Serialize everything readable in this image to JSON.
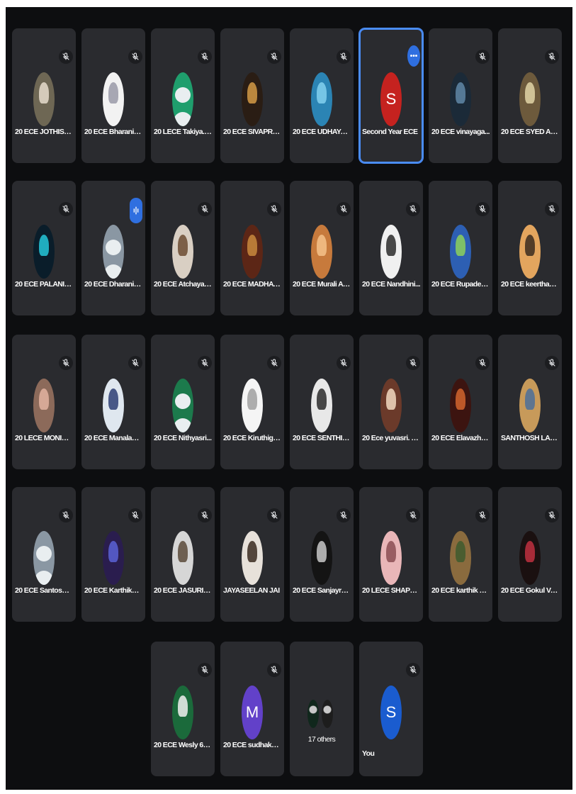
{
  "grid": {
    "tiles": [
      {
        "name": "20 ECE JOTHISIVA...",
        "avatar_type": "photo",
        "bg": "#6e6754",
        "accent": "#e6dccc",
        "muted": true
      },
      {
        "name": "20 ECE Bharani N ...",
        "avatar_type": "photo",
        "bg": "#f2f2f2",
        "accent": "#9a9aa8",
        "muted": true
      },
      {
        "name": "20 LECE Takiya.k ...",
        "avatar_type": "default",
        "bg": "#1f9e6d",
        "accent": "#e9eef0",
        "muted": true
      },
      {
        "name": "20 ECE SIVAPRIYA...",
        "avatar_type": "photo",
        "bg": "#2a1d14",
        "accent": "#d49a45",
        "muted": true
      },
      {
        "name": "20 ECE UDHAYAS...",
        "avatar_type": "photo",
        "bg": "#2b84b4",
        "accent": "#83d0ef",
        "muted": true
      },
      {
        "name": "Second Year ECE",
        "avatar_type": "letter",
        "letter": "S",
        "bg": "#c5221f",
        "accent": "#ffffff",
        "muted": false,
        "active": true,
        "more_label": "•••"
      },
      {
        "name": "20 ECE vinayaga...",
        "avatar_type": "photo",
        "bg": "#1b2a38",
        "accent": "#5f87a7",
        "muted": true
      },
      {
        "name": "20 ECE SYED ALI...",
        "avatar_type": "photo",
        "bg": "#6d5a3c",
        "accent": "#e2d5a6",
        "muted": true
      },
      {
        "name": "20 ECE PALANIVE...",
        "avatar_type": "photo",
        "bg": "#0a1d2a",
        "accent": "#25c7d9",
        "muted": true
      },
      {
        "name": "20 ECE Dharani M...",
        "avatar_type": "default",
        "bg": "#8a97a3",
        "accent": "#e9eef0",
        "muted": false,
        "speaking": true
      },
      {
        "name": "20 ECE Atchaya K...",
        "avatar_type": "photo",
        "bg": "#d9cfc3",
        "accent": "#6b4b31",
        "muted": true
      },
      {
        "name": "20 ECE MADHAVA...",
        "avatar_type": "photo",
        "bg": "#5c2616",
        "accent": "#c88a3d",
        "muted": true
      },
      {
        "name": "20 ECE Murali A 6...",
        "avatar_type": "photo",
        "bg": "#c77a3c",
        "accent": "#f4c28a",
        "muted": true
      },
      {
        "name": "20 ECE Nandhini...",
        "avatar_type": "photo",
        "bg": "#f0f0f0",
        "accent": "#2a2a2a",
        "muted": true
      },
      {
        "name": "20 ECE Rupadevi ...",
        "avatar_type": "photo",
        "bg": "#2d5fb3",
        "accent": "#8dd05a",
        "muted": true
      },
      {
        "name": "20 ECE keerthana...",
        "avatar_type": "photo",
        "bg": "#e3a55e",
        "accent": "#3a2a1e",
        "muted": true
      },
      {
        "name": "20 LECE MONISH ...",
        "avatar_type": "photo",
        "bg": "#8c6a5a",
        "accent": "#e3b3a1",
        "muted": true
      },
      {
        "name": "20 ECE Manalaksh...",
        "avatar_type": "photo",
        "bg": "#dfe7ef",
        "accent": "#2e3e74",
        "muted": true
      },
      {
        "name": "20 ECE Nithyasri...",
        "avatar_type": "default",
        "bg": "#1c7a4c",
        "accent": "#e9eef0",
        "muted": true
      },
      {
        "name": "20 ECE Kiruthiga ...",
        "avatar_type": "photo",
        "bg": "#f5f5f5",
        "accent": "#a0a0a0",
        "muted": true
      },
      {
        "name": "20 ECE SENTHILK...",
        "avatar_type": "photo",
        "bg": "#e8e8e8",
        "accent": "#2a2a2a",
        "muted": true
      },
      {
        "name": "20 Ece yuvasri. V ...",
        "avatar_type": "photo",
        "bg": "#6b3a2a",
        "accent": "#f2d9c0",
        "muted": true
      },
      {
        "name": "20 ECE Elavazhag...",
        "avatar_type": "photo",
        "bg": "#3c1410",
        "accent": "#d2642e",
        "muted": true
      },
      {
        "name": "SANTHOSH LAKS...",
        "avatar_type": "photo",
        "bg": "#c79a5a",
        "accent": "#4b6f9a",
        "muted": true
      },
      {
        "name": "20 ECE Santosh V ...",
        "avatar_type": "default",
        "bg": "#8a97a3",
        "accent": "#e9eef0",
        "muted": true
      },
      {
        "name": "20 ECE Karthikey...",
        "avatar_type": "photo",
        "bg": "#2a1d4e",
        "accent": "#5b61d6",
        "muted": true
      },
      {
        "name": "20 ECE JASURIYA...",
        "avatar_type": "photo",
        "bg": "#d6d6d6",
        "accent": "#5a4a3a",
        "muted": true
      },
      {
        "name": "JAYASEELAN JAI",
        "avatar_type": "photo",
        "bg": "#e7e1da",
        "accent": "#3a2a20",
        "muted": true
      },
      {
        "name": "20 ECE Sanjayraj ...",
        "avatar_type": "photo",
        "bg": "#141414",
        "accent": "#c8c8c8",
        "muted": true
      },
      {
        "name": "20 LECE SHAPNA ...",
        "avatar_type": "photo",
        "bg": "#e9b6b8",
        "accent": "#8b4e52",
        "muted": true
      },
      {
        "name": "20 ECE karthik S 6...",
        "avatar_type": "photo",
        "bg": "#8a6b3e",
        "accent": "#3d5a2e",
        "muted": true
      },
      {
        "name": "20 ECE Gokul Vas...",
        "avatar_type": "photo",
        "bg": "#1a1010",
        "accent": "#c03040",
        "muted": true
      },
      {
        "name": "20 ECE Wesly 6045",
        "avatar_type": "photo",
        "bg": "#1b6a3b",
        "accent": "#f0f0f0",
        "muted": true
      },
      {
        "name": "20 ECE sudhakar ...",
        "avatar_type": "letter",
        "letter": "M",
        "bg": "#6241c9",
        "accent": "#ffffff",
        "muted": true
      },
      {
        "name": "17 others",
        "avatar_type": "others",
        "bg": "#2a2b2f",
        "accent": "#c8c8c8",
        "muted": false
      },
      {
        "name": "You",
        "avatar_type": "letter",
        "letter": "S",
        "bg": "#1a5ccf",
        "accent": "#ffffff",
        "muted": true
      }
    ]
  }
}
